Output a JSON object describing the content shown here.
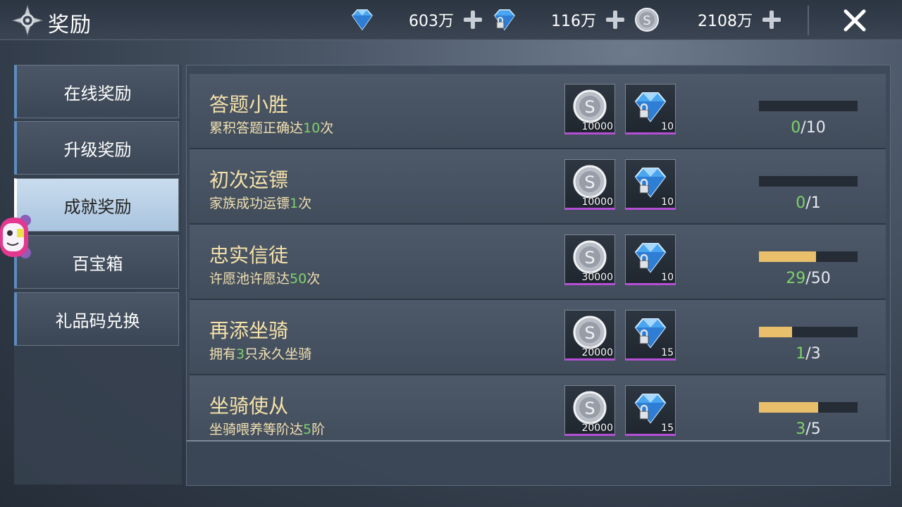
{
  "header": {
    "title": "奖励",
    "currencies": [
      {
        "icon": "diamond-icon",
        "amount": "603万"
      },
      {
        "icon": "locked-diamond-icon",
        "amount": "116万"
      },
      {
        "icon": "silver-coin-icon",
        "amount": "2108万"
      }
    ]
  },
  "sidebar": {
    "items": [
      {
        "label": "在线奖励",
        "active": false
      },
      {
        "label": "升级奖励",
        "active": false
      },
      {
        "label": "成就奖励",
        "active": true
      },
      {
        "label": "百宝箱",
        "active": false
      },
      {
        "label": "礼品码兑换",
        "active": false
      }
    ]
  },
  "achievements": [
    {
      "title": "答题小胜",
      "desc_pre": "累积答题正确达",
      "desc_num": "10",
      "desc_post": "次",
      "coin": "10000",
      "gem": "10",
      "current": "0",
      "total": "/10",
      "progress": 0
    },
    {
      "title": "初次运镖",
      "desc_pre": "家族成功运镖",
      "desc_num": "1",
      "desc_post": "次",
      "coin": "10000",
      "gem": "10",
      "current": "0",
      "total": "/1",
      "progress": 0
    },
    {
      "title": "忠实信徒",
      "desc_pre": "许愿池许愿达",
      "desc_num": "50",
      "desc_post": "次",
      "coin": "30000",
      "gem": "10",
      "current": "29",
      "total": "/50",
      "progress": 0.58
    },
    {
      "title": "再添坐骑",
      "desc_pre": "拥有",
      "desc_num": "3",
      "desc_post": "只永久坐骑",
      "coin": "20000",
      "gem": "15",
      "current": "1",
      "total": "/3",
      "progress": 0.333
    },
    {
      "title": "坐骑使从",
      "desc_pre": "坐骑喂养等阶达",
      "desc_num": "5",
      "desc_post": "阶",
      "coin": "20000",
      "gem": "15",
      "current": "3",
      "total": "/5",
      "progress": 0.6
    }
  ],
  "colors": {
    "accent_gold": "#e9bf6c",
    "highlight_green": "#7fd36a",
    "title_gold": "#f6e2a8",
    "active_tab": "#c9dcee"
  }
}
